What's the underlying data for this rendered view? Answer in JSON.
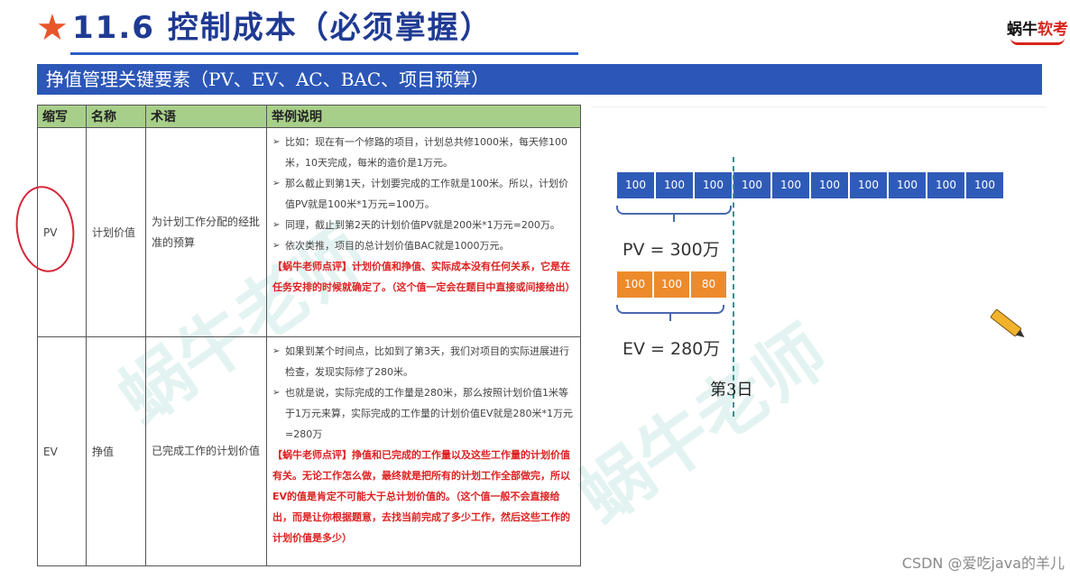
{
  "header": {
    "star": "★",
    "title": "11.6 控制成本（必须掌握）",
    "logo_text_a": "蜗牛",
    "logo_text_b": "软考"
  },
  "section": {
    "title": "挣值管理关键要素（PV、EV、AC、BAC、项目预算）"
  },
  "table": {
    "headers": [
      "缩写",
      "名称",
      "术语",
      "举例说明"
    ],
    "rows": [
      {
        "abbr": "PV",
        "name": "计划价值",
        "term": "为计划工作分配的经批准的预算",
        "bullets": [
          "比如：现在有一个修路的项目，计划总共修1000米，每天修100米，10天完成，每米的造价是1万元。",
          "那么截止到第1天，计划要完成的工作就是100米。所以，计划价值PV就是100米*1万元=100万。",
          "同理，截止到第2天的计划价值PV就是200米*1万元=200万。",
          "依次类推，项目的总计划价值BAC就是1000万元。"
        ],
        "note": "【蜗牛老师点评】计划价值和挣值、实际成本没有任何关系，它是在任务安排的时候就确定了。（这个值一定会在题目中直接或间接给出）"
      },
      {
        "abbr": "EV",
        "name": "挣值",
        "term": "已完成工作的计划价值",
        "bullets": [
          "如果到某个时间点，比如到了第3天，我们对项目的实际进展进行检查，发现实际修了280米。",
          "也就是说，实际完成的工作量是280米，那么按照计划价值1米等于1万元来算，实际完成的工作量的计划价值EV就是280米*1万元=280万"
        ],
        "note": "【蜗牛老师点评】挣值和已完成的工作量以及这些工作量的计划价值有关。无论工作怎么做，最终就是把所有的计划工作全部做完，所以EV的值是肯定不可能大于总计划价值的。（这个值一般不会直接给出，而是让你根据题意，去找当前完成了多少工作，然后这些工作的计划价值是多少）"
      }
    ]
  },
  "diagram": {
    "pv_cells": [
      "100",
      "100",
      "100",
      "100",
      "100",
      "100",
      "100",
      "100",
      "100",
      "100"
    ],
    "pv_label": "PV = 300万",
    "ev_cells": [
      "100",
      "100",
      "80"
    ],
    "ev_label": "EV = 280万",
    "day_label": "第3日",
    "colors": {
      "pv": "#2f5bb8",
      "ev": "#ed8a2c"
    }
  },
  "watermark": [
    "蜗牛老师",
    "蜗牛老师"
  ],
  "footer": {
    "credit": "CSDN @爱吃java的羊儿"
  }
}
